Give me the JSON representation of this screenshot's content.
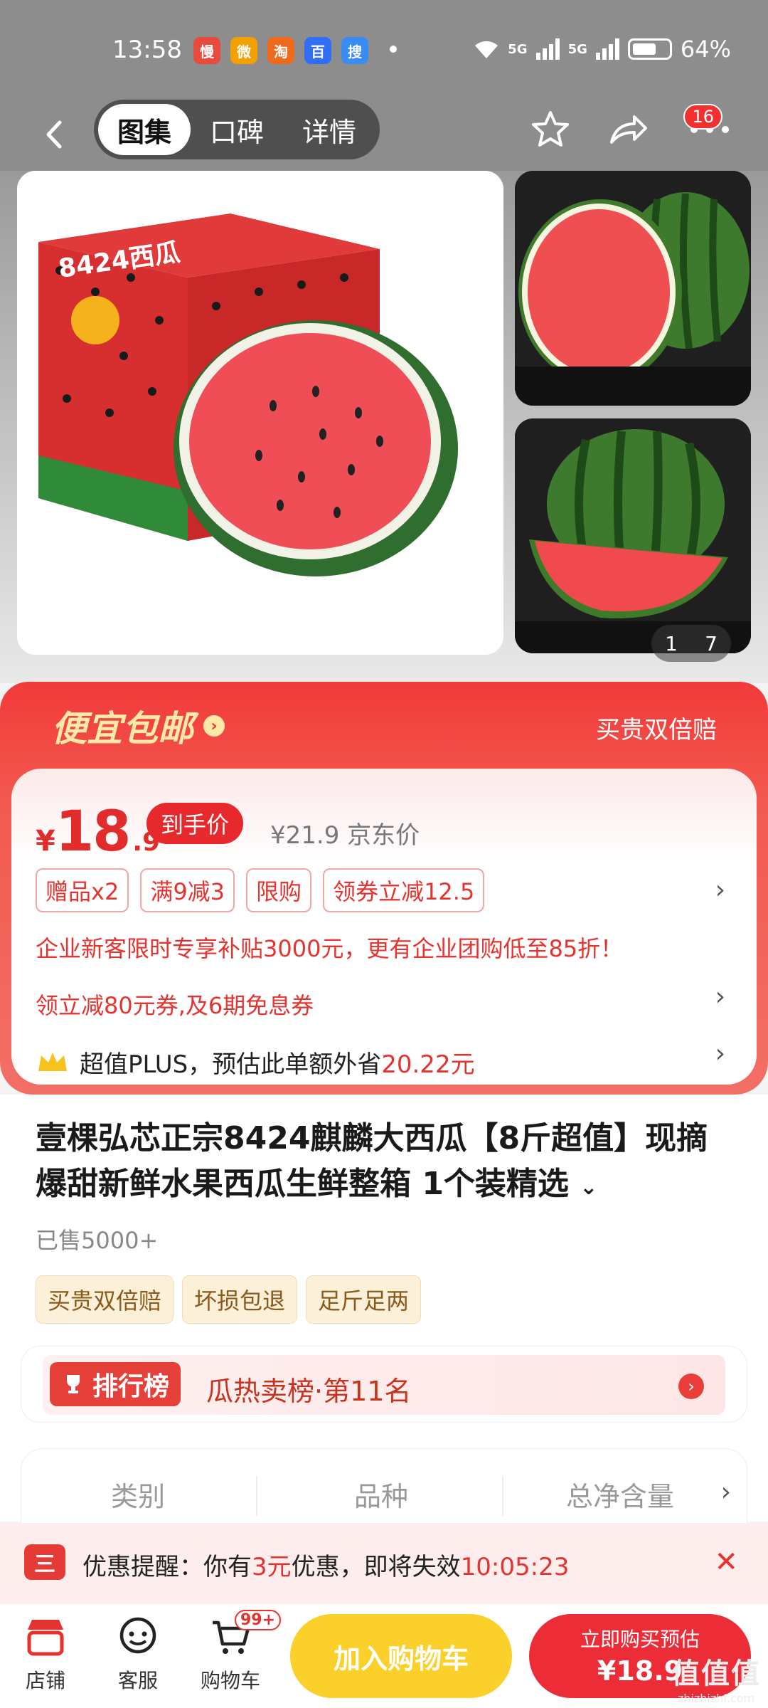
{
  "status": {
    "time": "13:58",
    "battery": "64%",
    "network1": "5G",
    "network2": "5G",
    "apps": [
      "慢",
      "微",
      "淘",
      "百",
      "搜"
    ]
  },
  "nav": {
    "tabs": [
      "图集",
      "口碑",
      "详情"
    ],
    "active_tab": "图集",
    "more_badge": "16"
  },
  "gallery": {
    "pager_current": "1",
    "pager_total": "7",
    "box_text": "8424西瓜"
  },
  "promo": {
    "headline": "便宜包邮",
    "guarantee": "买贵双倍赔",
    "price_symbol": "¥",
    "price_int": "18",
    "price_dec": ".9",
    "price_tag": "到手价",
    "jd_price": "¥21.9 京东价",
    "chips": [
      "赠品x2",
      "满9减3",
      "限购",
      "领券立减12.5"
    ],
    "enterprise_line": "企业新客限时专享补贴3000元，更有企业团购低至85折！",
    "coupon_line": "领立减80元券,及6期免息券",
    "plus_prefix": "超值PLUS，预估此单额外省",
    "plus_amount": "20.22元"
  },
  "product": {
    "title": "壹棵弘芯正宗8424麒麟大西瓜【8斤超值】现摘爆甜新鲜水果西瓜生鲜整箱 1个装精选",
    "sold": "已售5000+",
    "services": [
      "买贵双倍赔",
      "坏损包退",
      "足斤足两"
    ],
    "rank_tag": "排行榜",
    "rank_text": "瓜热卖榜·第11名"
  },
  "specs": [
    "类别",
    "品种",
    "总净含量"
  ],
  "reminder": {
    "icon_text": "三",
    "prefix": "优惠提醒：你有",
    "amount": "3元",
    "middle": "优惠，即将失效",
    "countdown": "10:05:23"
  },
  "bottom": {
    "shop": "店铺",
    "service": "客服",
    "cart": "购物车",
    "cart_badge": "99+",
    "add_cart": "加入购物车",
    "buy_line1": "立即购买预估",
    "buy_line2": "¥18.9"
  },
  "watermark": {
    "main": "值值值",
    "sub": "zhizhizhi.com"
  },
  "colors": {
    "accent_red": "#e5332f",
    "cart_yellow": "#fcd02a",
    "buy_red": "#ec2c36"
  }
}
